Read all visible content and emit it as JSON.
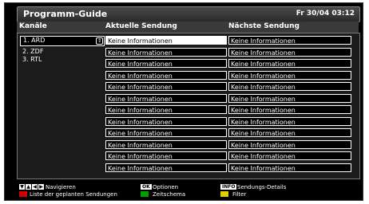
{
  "header": {
    "title": "Programm-Guide",
    "datetime": "Fr 30/04 03:12"
  },
  "columns": {
    "channels": "Kanäle",
    "current": "Aktuelle Sendung",
    "next": "Nächste Sendung"
  },
  "channels": [
    "1. ARD",
    "2. ZDF",
    "3. RTL"
  ],
  "rows": [
    {
      "current": "Keine Informationen",
      "next": "Keine Informationen"
    },
    {
      "current": "Keine Informationen",
      "next": "Keine Informationen"
    },
    {
      "current": "Keine Informationen",
      "next": "Keine Informationen"
    },
    {
      "current": "Keine Informationen",
      "next": "Keine Informationen"
    },
    {
      "current": "Keine Informationen",
      "next": "Keine Informationen"
    },
    {
      "current": "Keine Informationen",
      "next": "Keine Informationen"
    },
    {
      "current": "Keine Informationen",
      "next": "Keine Informationen"
    },
    {
      "current": "Keine Informationen",
      "next": "Keine Informationen"
    },
    {
      "current": "Keine Informationen",
      "next": "Keine Informationen"
    },
    {
      "current": "Keine Informationen",
      "next": "Keine Informationen"
    },
    {
      "current": "Keine Informationen",
      "next": "Keine Informationen"
    },
    {
      "current": "Keine Informationen",
      "next": "Keine Informationen"
    }
  ],
  "footer": {
    "nav_label": "Navigieren",
    "nav_icons": [
      "arrow-down-icon",
      "arrow-up-icon",
      "arrow-left-icon",
      "arrow-right-icon"
    ],
    "ok_key": "OK",
    "ok_label": "Optionen",
    "info_key": "INFO",
    "info_label": "Sendungs-Details",
    "red_label": "Liste der geplanten Sendungen",
    "green_label": "Zeitschema",
    "yellow_label": "Filter",
    "colors": {
      "red": "#d40000",
      "green": "#00a000",
      "yellow": "#e0d000"
    }
  }
}
